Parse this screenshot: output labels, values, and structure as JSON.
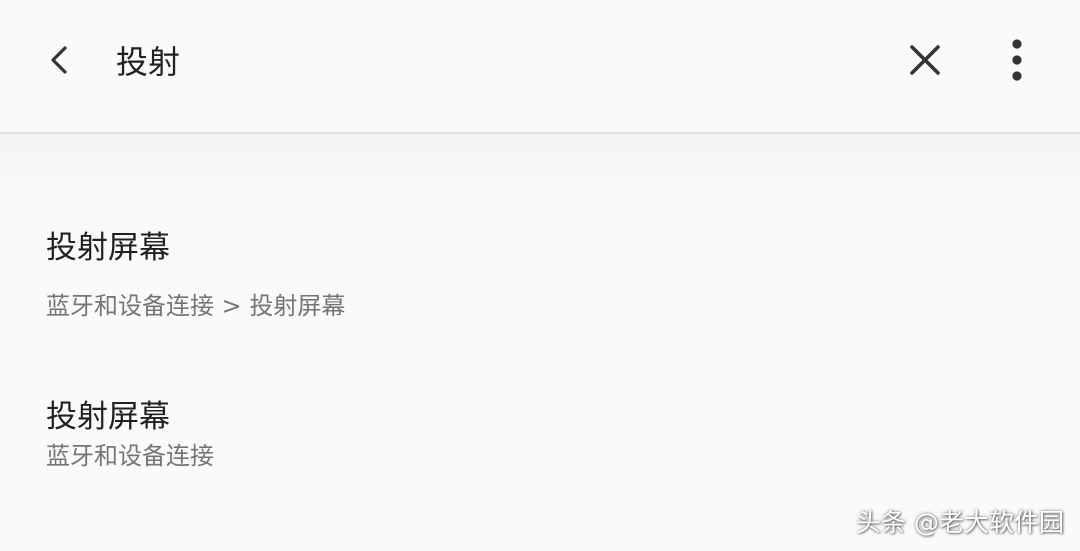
{
  "toolbar": {
    "search_value": "投射",
    "back_icon": "arrow-back-icon",
    "clear_icon": "close-icon",
    "more_icon": "more-vert-icon"
  },
  "results": [
    {
      "title": "投射屏幕",
      "path": "蓝牙和设备连接 > 投射屏幕"
    },
    {
      "title": "投射屏幕",
      "path": "蓝牙和设备连接"
    }
  ],
  "watermark": "头条 @老大软件园",
  "colors": {
    "background": "#fafafa",
    "divider": "#e0e0e0",
    "title_text": "#212121",
    "secondary_text": "#757575"
  }
}
